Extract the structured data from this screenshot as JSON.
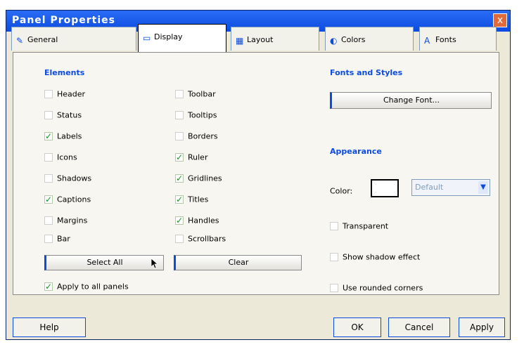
{
  "window": {
    "title": "Panel Properties",
    "close_glyph": "x"
  },
  "tabs": [
    {
      "label": "General",
      "icon": "brush-icon"
    },
    {
      "label": "Display",
      "icon": "display-icon"
    },
    {
      "label": "Layout",
      "icon": "layout-icon"
    },
    {
      "label": "Colors",
      "icon": "palette-icon"
    },
    {
      "label": "Fonts",
      "icon": "font-icon"
    }
  ],
  "left_group": {
    "title": "Elements",
    "checkboxes": [
      {
        "label": "Header",
        "checked": false
      },
      {
        "label": "Toolbar",
        "checked": false
      },
      {
        "label": "Status",
        "checked": false
      },
      {
        "label": "Tooltips",
        "checked": false
      },
      {
        "label": "Labels",
        "checked": true
      },
      {
        "label": "Borders",
        "checked": false
      },
      {
        "label": "Icons",
        "checked": false
      },
      {
        "label": "Ruler",
        "checked": true
      },
      {
        "label": "Shadows",
        "checked": false
      },
      {
        "label": "Gridlines",
        "checked": true
      },
      {
        "label": "Captions",
        "checked": true
      },
      {
        "label": "Titles",
        "checked": true
      },
      {
        "label": "Margins",
        "checked": false
      },
      {
        "label": "Handles",
        "checked": true
      },
      {
        "label": "Bar",
        "checked": false
      },
      {
        "label": "Scrollbars",
        "checked": false
      }
    ],
    "buttons": [
      "Select All",
      "Clear"
    ],
    "apply_all": {
      "label": "Apply to all panels",
      "checked": true
    }
  },
  "right_group": {
    "fonts_title": "Fonts and Styles",
    "fonts_button": "Change Font...",
    "appearance_title": "Appearance",
    "color_label": "Color:",
    "color_value": "Default",
    "options": [
      {
        "label": "Transparent",
        "checked": false
      },
      {
        "label": "Show shadow effect",
        "checked": false
      },
      {
        "label": "Use rounded corners",
        "checked": false
      }
    ]
  },
  "footer": {
    "help": "Help",
    "ok": "OK",
    "cancel": "Cancel",
    "apply": "Apply"
  }
}
